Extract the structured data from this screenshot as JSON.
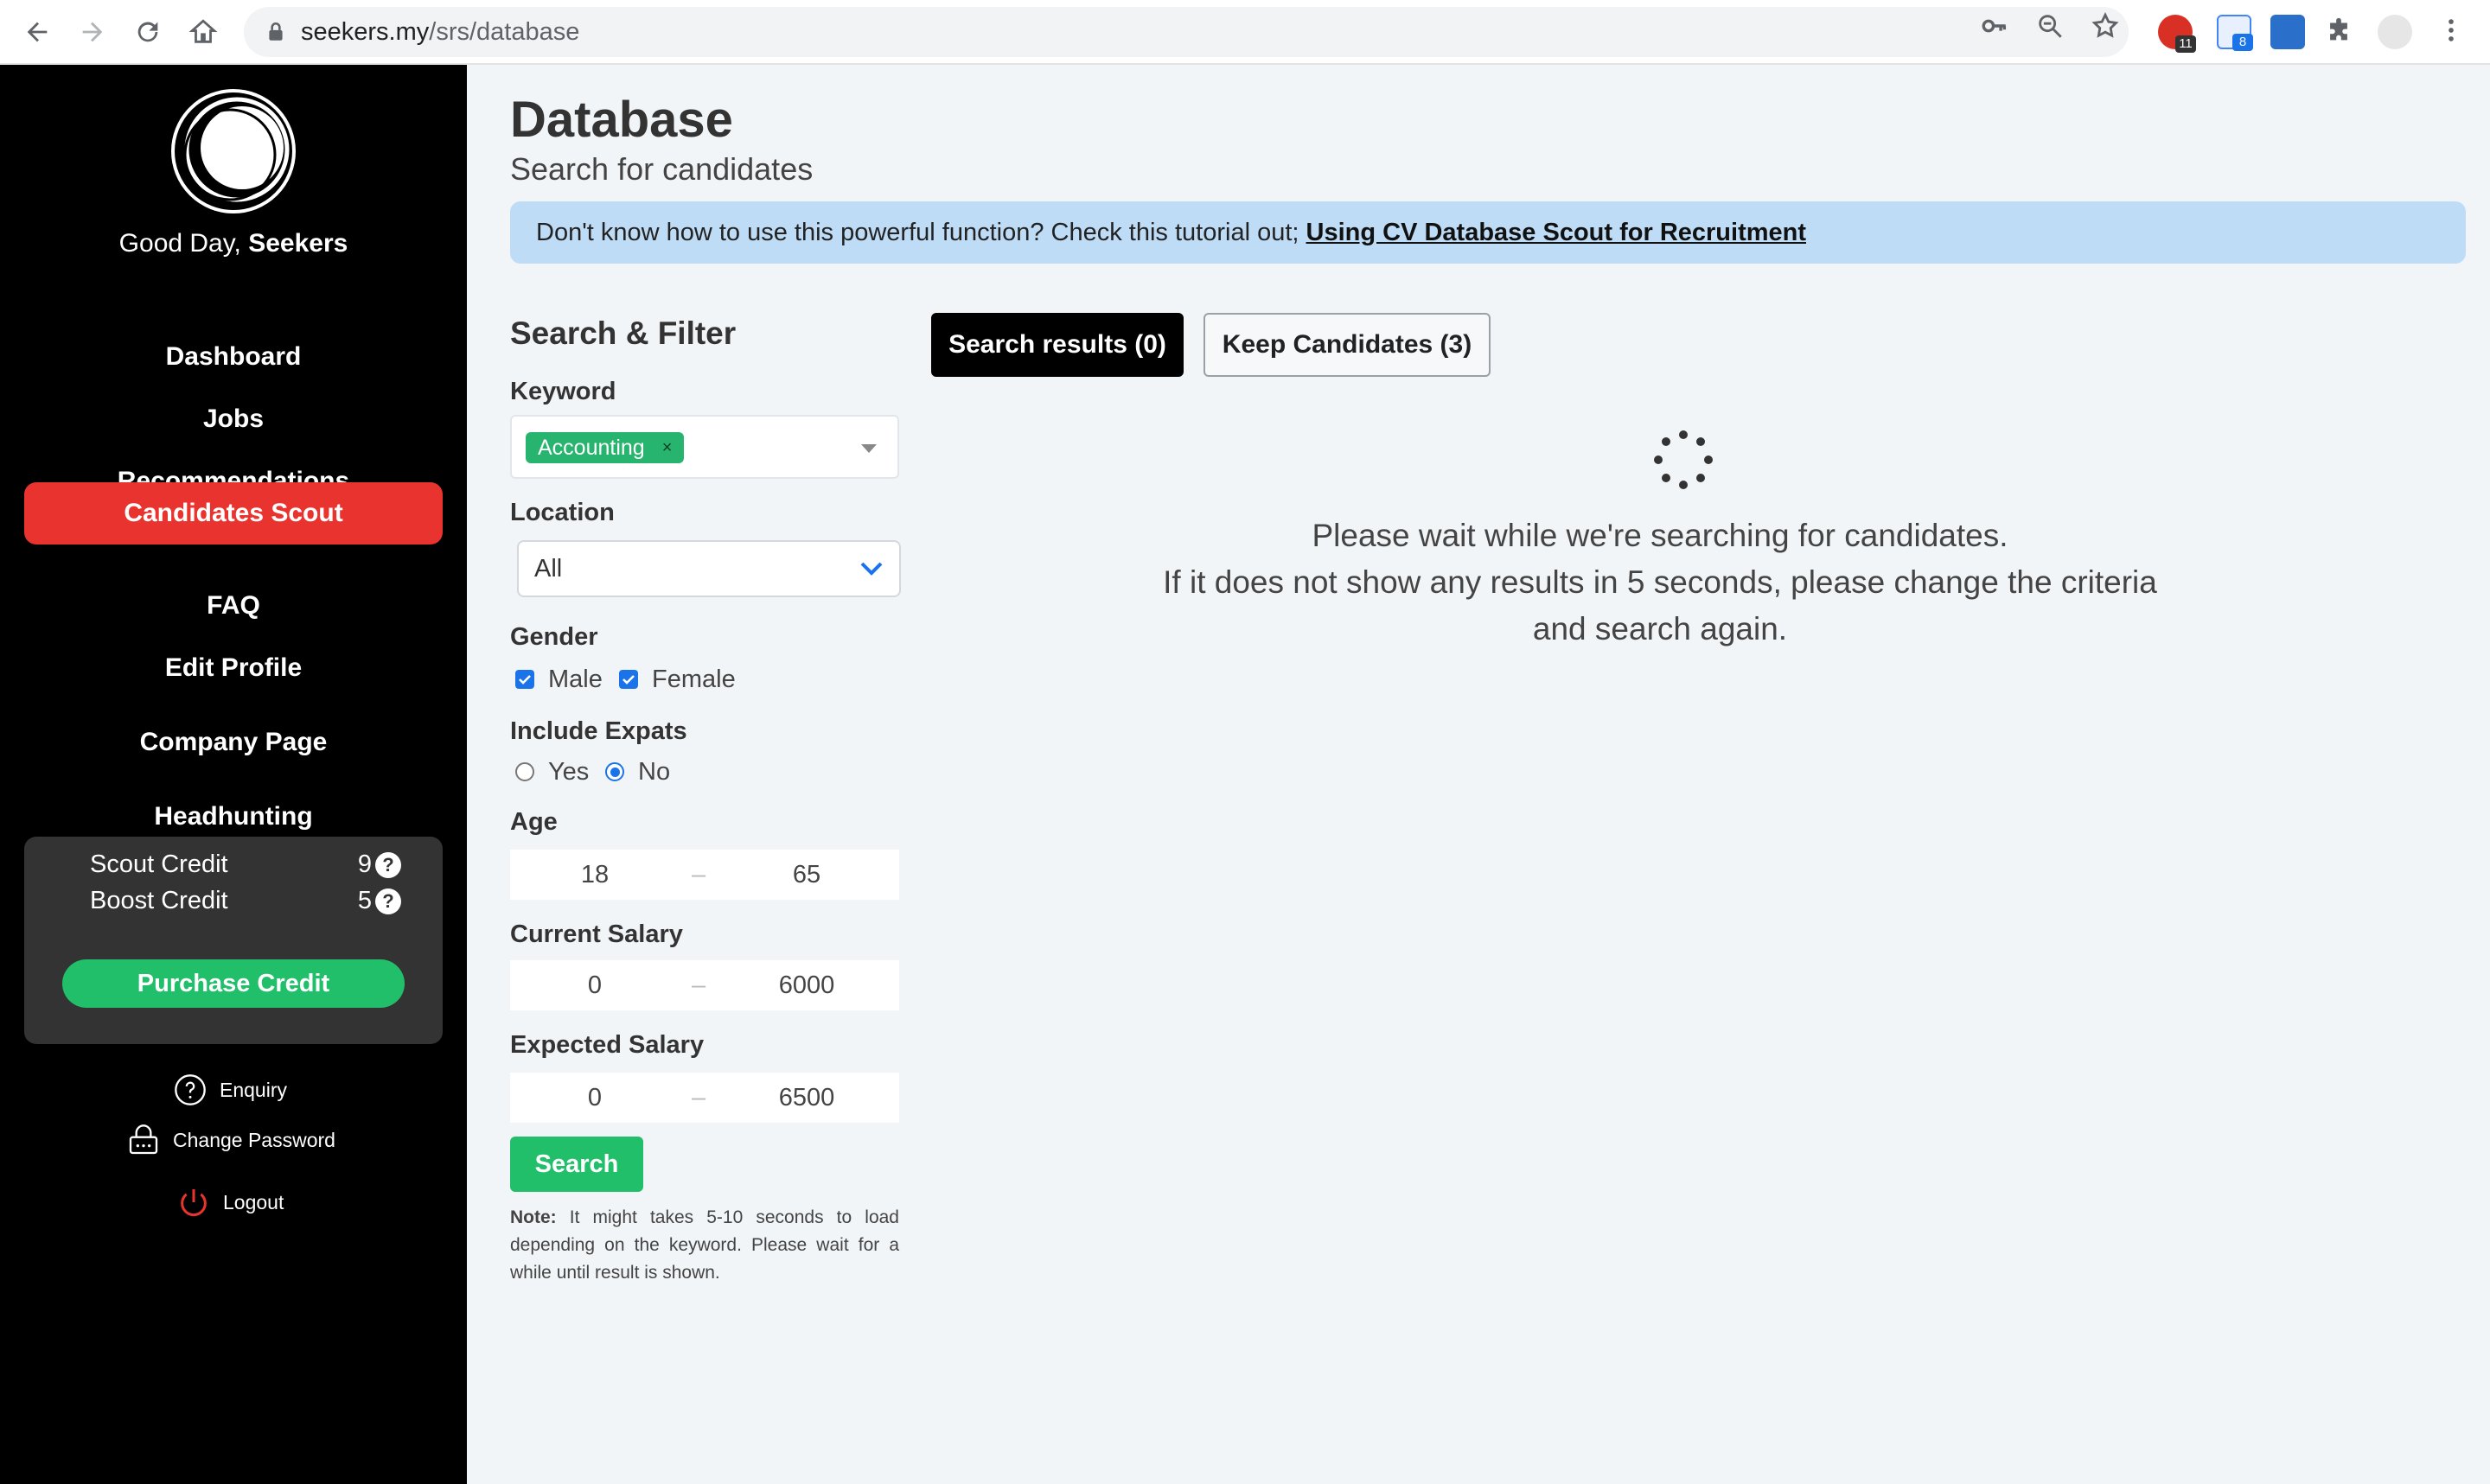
{
  "browser": {
    "url_host": "seekers.my",
    "url_path": "/srs/database",
    "extension_badges": [
      "11",
      "8"
    ]
  },
  "sidebar": {
    "greeting_prefix": "Good Day,",
    "greeting_name": "Seekers",
    "nav": [
      {
        "label": "Dashboard"
      },
      {
        "label": "Jobs"
      },
      {
        "label": "Recommendations"
      },
      {
        "label": "Candidates Scout"
      },
      {
        "label": "FAQ"
      },
      {
        "label": "Edit Profile"
      },
      {
        "label": "Company Page"
      },
      {
        "label": "Headhunting"
      }
    ],
    "active_nav": "Candidates Scout",
    "credits": {
      "scout_label": "Scout Credit",
      "scout_value": "9",
      "boost_label": "Boost Credit",
      "boost_value": "5",
      "purchase_label": "Purchase Credit"
    },
    "links": {
      "enquiry": "Enquiry",
      "change_password": "Change Password",
      "logout": "Logout"
    }
  },
  "page": {
    "title": "Database",
    "subtitle": "Search for candidates",
    "banner_text": "Don't know how to use this powerful function? Check this tutorial out; ",
    "banner_link": "Using CV Database Scout for Recruitment"
  },
  "filter": {
    "title": "Search & Filter",
    "keyword_label": "Keyword",
    "keyword_tag": "Accounting",
    "keyword_tag_remove": "×",
    "location_label": "Location",
    "location_value": "All",
    "gender_label": "Gender",
    "gender_male": "Male",
    "gender_female": "Female",
    "expats_label": "Include Expats",
    "expats_yes": "Yes",
    "expats_no": "No",
    "age_label": "Age",
    "age_min": "18",
    "age_max": "65",
    "current_salary_label": "Current Salary",
    "current_salary_min": "0",
    "current_salary_max": "6000",
    "expected_salary_label": "Expected Salary",
    "expected_salary_min": "0",
    "expected_salary_max": "6500",
    "range_separator": "–",
    "search_label": "Search",
    "note_prefix": "Note:",
    "note_text": " It might takes 5-10 seconds to load depending on the keyword. Please wait for a while until result is shown."
  },
  "results": {
    "tab_results": "Search results (0)",
    "tab_keep": "Keep Candidates (3)",
    "wait_line1": "Please wait while we're searching for candidates.",
    "wait_line2": "If it does not show any results in 5 seconds, please change the criteria and search again."
  },
  "colors": {
    "active_nav": "#e9332f",
    "accent_green": "#22bf6a",
    "banner_bg": "#bfdcf7",
    "checkbox_blue": "#1a73e8"
  },
  "icons": [
    "back-arrow-icon",
    "forward-arrow-icon",
    "reload-icon",
    "home-icon",
    "lock-icon",
    "key-icon",
    "zoom-icon",
    "star-icon",
    "puzzle-icon",
    "question-icon",
    "password-lock-icon",
    "power-icon",
    "chevron-down-icon",
    "spinner-icon"
  ]
}
